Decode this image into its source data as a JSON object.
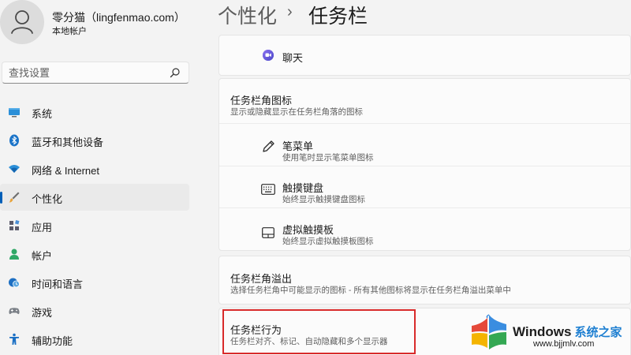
{
  "user": {
    "name": "零分猫（lingfenmao.com）",
    "account_type": "本地帐户"
  },
  "search": {
    "placeholder": "查找设置"
  },
  "nav": {
    "items": [
      {
        "label": "系统",
        "icon": "monitor-icon"
      },
      {
        "label": "蓝牙和其他设备",
        "icon": "bluetooth-icon"
      },
      {
        "label": "网络 & Internet",
        "icon": "wifi-icon"
      },
      {
        "label": "个性化",
        "icon": "brush-icon",
        "active": true
      },
      {
        "label": "应用",
        "icon": "apps-icon"
      },
      {
        "label": "帐户",
        "icon": "account-icon"
      },
      {
        "label": "时间和语言",
        "icon": "globe-clock-icon"
      },
      {
        "label": "游戏",
        "icon": "gamepad-icon"
      },
      {
        "label": "辅助功能",
        "icon": "accessibility-icon"
      }
    ],
    "accent_color": "#005fb8"
  },
  "breadcrumb": {
    "parent": "个性化",
    "separator": "›",
    "current": "任务栏"
  },
  "chat_row": {
    "label": "聊天",
    "icon": "chat-icon"
  },
  "corner_icons": {
    "title": "任务栏角图标",
    "description": "显示或隐藏显示在任务栏角落的图标",
    "items": [
      {
        "title": "笔菜单",
        "description": "使用笔时显示笔菜单图标",
        "icon": "pen-icon"
      },
      {
        "title": "触摸键盘",
        "description": "始终显示触摸键盘图标",
        "icon": "keyboard-icon"
      },
      {
        "title": "虚拟触摸板",
        "description": "始终显示虚拟触摸板图标",
        "icon": "touchpad-icon"
      }
    ]
  },
  "overflow": {
    "title": "任务栏角溢出",
    "description": "选择任务栏角中可能显示的图标 - 所有其他图标将显示在任务栏角溢出菜单中"
  },
  "behaviors": {
    "title": "任务栏行为",
    "description": "任务栏对齐、标记、自动隐藏和多个显示器",
    "highlight_color": "#d82a2a"
  },
  "watermark": {
    "brand": "Windows",
    "brand_cn": "系统之家",
    "url": "www.bjjmlv.com"
  }
}
